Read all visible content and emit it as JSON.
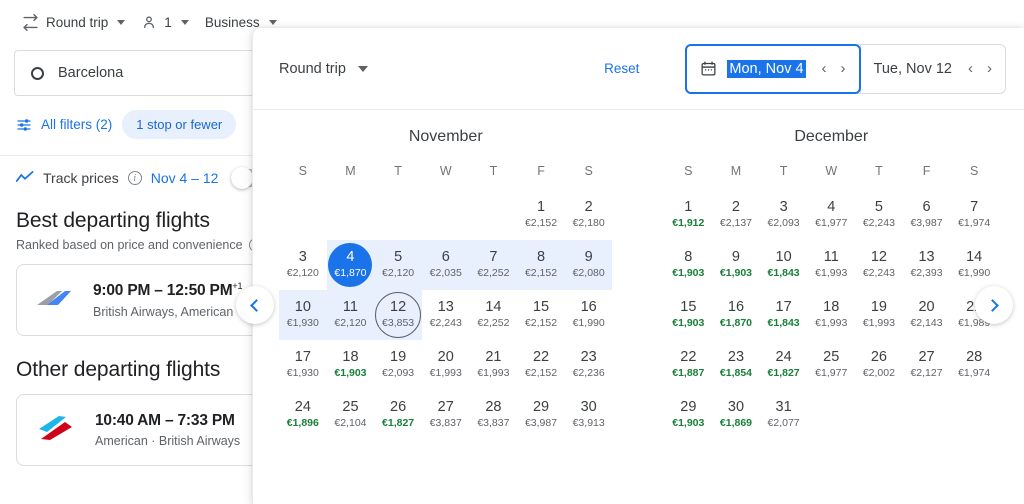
{
  "topbar": {
    "trip_type": "Round trip",
    "passengers": "1",
    "cabin": "Business",
    "swap_icon": "swap-horizontal-icon",
    "person_icon": "person-icon"
  },
  "origin": {
    "value": "Barcelona",
    "icon": "circle-origin-icon"
  },
  "filters": {
    "all_filters_label": "All filters (2)",
    "filters_icon": "tune-filter-icon",
    "chip_label": "1 stop or fewer"
  },
  "track_prices": {
    "icon": "trending-line-icon",
    "label": "Track prices",
    "info_icon": "info-icon",
    "dates": "Nov 4 – 12",
    "toggle_state": "off"
  },
  "sections": {
    "best_title": "Best departing flights",
    "best_subtitle": "Ranked based on price and convenience",
    "best_subtitle_info_icon": "info-icon",
    "other_title": "Other departing flights"
  },
  "flights": [
    {
      "times": "9:00 PM – 12:50 PM",
      "sup": "+1",
      "airlines": "British Airways, American",
      "logo": "british-airways-logo"
    },
    {
      "times": "10:40 AM – 7:33 PM",
      "sup": "",
      "airlines": "American · British Airways",
      "logo": "american-airlines-logo"
    }
  ],
  "calendar": {
    "trip_type": "Round trip",
    "reset_label": "Reset",
    "calendar_icon": "calendar-icon",
    "departure": {
      "value": "Mon, Nov 4",
      "selected": true,
      "prev_icon": "chevron-left-icon",
      "next_icon": "chevron-right-icon"
    },
    "return": {
      "value": "Tue, Nov 12",
      "selected": false,
      "prev_icon": "chevron-left-icon",
      "next_icon": "chevron-right-icon"
    },
    "prev_month_icon": "chevron-left-icon",
    "next_month_icon": "chevron-right-icon",
    "dow": [
      "S",
      "M",
      "T",
      "W",
      "T",
      "F",
      "S"
    ],
    "accent_color": "#1a73e8",
    "range_color": "#e8f0fe",
    "cheap_color": "#188038",
    "months": [
      {
        "name": "November",
        "lead_blank": 5,
        "days": [
          {
            "d": 1,
            "price": "€2,152",
            "cheap": false
          },
          {
            "d": 2,
            "price": "€2,180",
            "cheap": false
          },
          {
            "d": 3,
            "price": "€2,120",
            "cheap": false
          },
          {
            "d": 4,
            "price": "€1,870",
            "cheap": false,
            "state": "start-sel"
          },
          {
            "d": 5,
            "price": "€2,120",
            "cheap": false,
            "state": "inrange"
          },
          {
            "d": 6,
            "price": "€2,035",
            "cheap": false,
            "state": "inrange"
          },
          {
            "d": 7,
            "price": "€2,252",
            "cheap": false,
            "state": "inrange"
          },
          {
            "d": 8,
            "price": "€2,152",
            "cheap": false,
            "state": "inrange"
          },
          {
            "d": 9,
            "price": "€2,080",
            "cheap": false,
            "state": "inrange"
          },
          {
            "d": 10,
            "price": "€1,930",
            "cheap": false,
            "state": "inrange"
          },
          {
            "d": 11,
            "price": "€2,120",
            "cheap": false,
            "state": "inrange"
          },
          {
            "d": 12,
            "price": "€3,853",
            "cheap": false,
            "state": "end-out"
          },
          {
            "d": 13,
            "price": "€2,243",
            "cheap": false
          },
          {
            "d": 14,
            "price": "€2,252",
            "cheap": false
          },
          {
            "d": 15,
            "price": "€2,152",
            "cheap": false
          },
          {
            "d": 16,
            "price": "€1,990",
            "cheap": false
          },
          {
            "d": 17,
            "price": "€1,930",
            "cheap": false
          },
          {
            "d": 18,
            "price": "€1,903",
            "cheap": true
          },
          {
            "d": 19,
            "price": "€2,093",
            "cheap": false
          },
          {
            "d": 20,
            "price": "€1,993",
            "cheap": false
          },
          {
            "d": 21,
            "price": "€1,993",
            "cheap": false
          },
          {
            "d": 22,
            "price": "€2,152",
            "cheap": false
          },
          {
            "d": 23,
            "price": "€2,236",
            "cheap": false
          },
          {
            "d": 24,
            "price": "€1,896",
            "cheap": true
          },
          {
            "d": 25,
            "price": "€2,104",
            "cheap": false
          },
          {
            "d": 26,
            "price": "€1,827",
            "cheap": true
          },
          {
            "d": 27,
            "price": "€3,837",
            "cheap": false
          },
          {
            "d": 28,
            "price": "€3,837",
            "cheap": false
          },
          {
            "d": 29,
            "price": "€3,987",
            "cheap": false
          },
          {
            "d": 30,
            "price": "€3,913",
            "cheap": false
          }
        ]
      },
      {
        "name": "December",
        "lead_blank": 0,
        "days": [
          {
            "d": 1,
            "price": "€1,912",
            "cheap": true
          },
          {
            "d": 2,
            "price": "€2,137",
            "cheap": false
          },
          {
            "d": 3,
            "price": "€2,093",
            "cheap": false
          },
          {
            "d": 4,
            "price": "€1,977",
            "cheap": false
          },
          {
            "d": 5,
            "price": "€2,243",
            "cheap": false
          },
          {
            "d": 6,
            "price": "€3,987",
            "cheap": false
          },
          {
            "d": 7,
            "price": "€1,974",
            "cheap": false
          },
          {
            "d": 8,
            "price": "€1,903",
            "cheap": true
          },
          {
            "d": 9,
            "price": "€1,903",
            "cheap": true
          },
          {
            "d": 10,
            "price": "€1,843",
            "cheap": true
          },
          {
            "d": 11,
            "price": "€1,993",
            "cheap": false
          },
          {
            "d": 12,
            "price": "€2,243",
            "cheap": false
          },
          {
            "d": 13,
            "price": "€2,393",
            "cheap": false
          },
          {
            "d": 14,
            "price": "€1,990",
            "cheap": false
          },
          {
            "d": 15,
            "price": "€1,903",
            "cheap": true
          },
          {
            "d": 16,
            "price": "€1,870",
            "cheap": true
          },
          {
            "d": 17,
            "price": "€1,843",
            "cheap": true
          },
          {
            "d": 18,
            "price": "€1,993",
            "cheap": false
          },
          {
            "d": 19,
            "price": "€1,993",
            "cheap": false
          },
          {
            "d": 20,
            "price": "€2,143",
            "cheap": false
          },
          {
            "d": 21,
            "price": "€1,989",
            "cheap": false
          },
          {
            "d": 22,
            "price": "€1,887",
            "cheap": true
          },
          {
            "d": 23,
            "price": "€1,854",
            "cheap": true
          },
          {
            "d": 24,
            "price": "€1,827",
            "cheap": true
          },
          {
            "d": 25,
            "price": "€1,977",
            "cheap": false
          },
          {
            "d": 26,
            "price": "€2,002",
            "cheap": false
          },
          {
            "d": 27,
            "price": "€2,127",
            "cheap": false
          },
          {
            "d": 28,
            "price": "€1,974",
            "cheap": false
          },
          {
            "d": 29,
            "price": "€1,903",
            "cheap": true
          },
          {
            "d": 30,
            "price": "€1,869",
            "cheap": true
          },
          {
            "d": 31,
            "price": "€2,077",
            "cheap": false
          }
        ]
      }
    ]
  }
}
